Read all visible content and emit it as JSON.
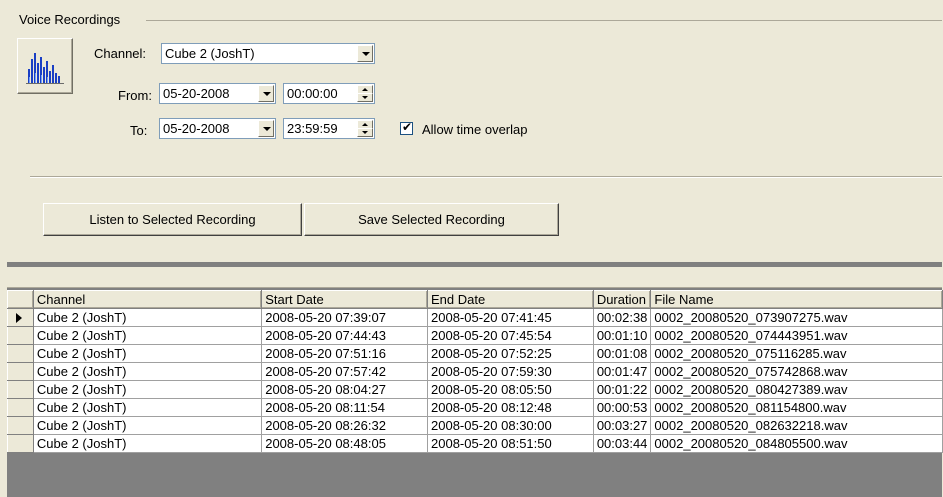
{
  "group": {
    "title": "Voice Recordings"
  },
  "icon": {
    "name": "audio-spectrum-icon"
  },
  "channel": {
    "label": "Channel:",
    "value": "Cube 2 (JoshT)"
  },
  "from": {
    "label": "From:",
    "date": "05-20-2008",
    "time": "00:00:00"
  },
  "to": {
    "label": "To:",
    "date": "05-20-2008",
    "time": "23:59:59"
  },
  "overlap": {
    "label": "Allow time overlap",
    "checked": true
  },
  "buttons": {
    "listen": "Listen to Selected Recording",
    "save": "Save Selected Recording"
  },
  "grid": {
    "columns": [
      "Channel",
      "Start Date",
      "End Date",
      "Duration",
      "File Name"
    ],
    "rows": [
      [
        "Cube 2 (JoshT)",
        "2008-05-20 07:39:07",
        "2008-05-20 07:41:45",
        "00:02:38",
        "0002_20080520_073907275.wav"
      ],
      [
        "Cube 2 (JoshT)",
        "2008-05-20 07:44:43",
        "2008-05-20 07:45:54",
        "00:01:10",
        "0002_20080520_074443951.wav"
      ],
      [
        "Cube 2 (JoshT)",
        "2008-05-20 07:51:16",
        "2008-05-20 07:52:25",
        "00:01:08",
        "0002_20080520_075116285.wav"
      ],
      [
        "Cube 2 (JoshT)",
        "2008-05-20 07:57:42",
        "2008-05-20 07:59:30",
        "00:01:47",
        "0002_20080520_075742868.wav"
      ],
      [
        "Cube 2 (JoshT)",
        "2008-05-20 08:04:27",
        "2008-05-20 08:05:50",
        "00:01:22",
        "0002_20080520_080427389.wav"
      ],
      [
        "Cube 2 (JoshT)",
        "2008-05-20 08:11:54",
        "2008-05-20 08:12:48",
        "00:00:53",
        "0002_20080520_081154800.wav"
      ],
      [
        "Cube 2 (JoshT)",
        "2008-05-20 08:26:32",
        "2008-05-20 08:30:00",
        "00:03:27",
        "0002_20080520_082632218.wav"
      ],
      [
        "Cube 2 (JoshT)",
        "2008-05-20 08:48:05",
        "2008-05-20 08:51:50",
        "00:03:44",
        "0002_20080520_084805500.wav"
      ]
    ]
  }
}
